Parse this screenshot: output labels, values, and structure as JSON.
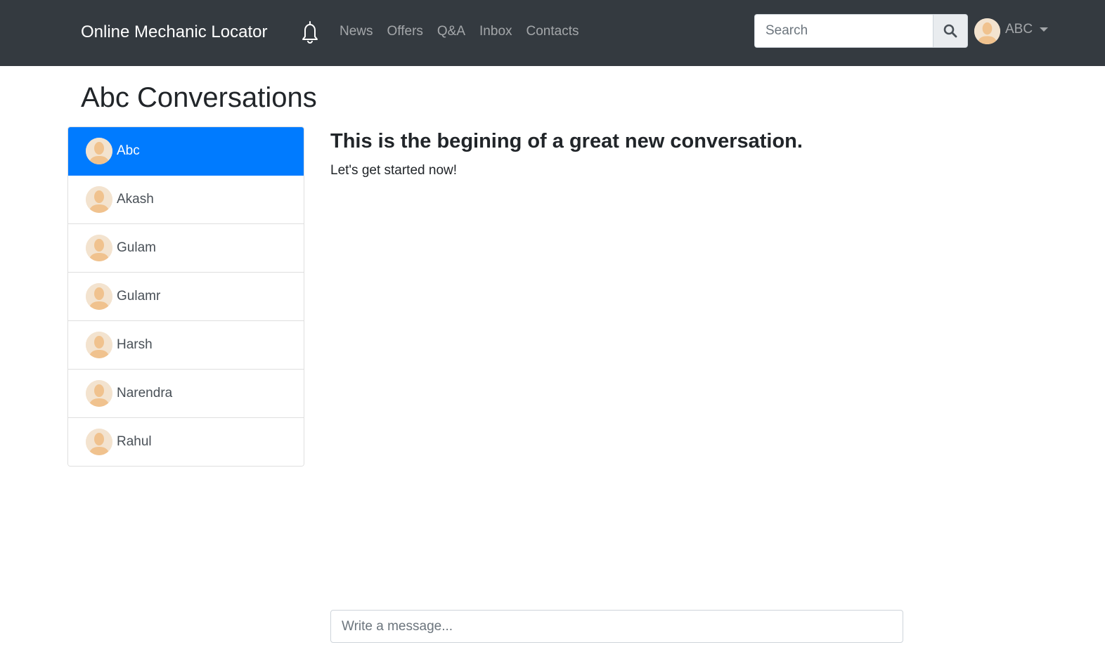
{
  "navbar": {
    "brand": "Online Mechanic Locator",
    "notification_icon": "bell-icon",
    "links": [
      "News",
      "Offers",
      "Q&A",
      "Inbox",
      "Contacts"
    ],
    "search": {
      "placeholder": "Search",
      "value": "",
      "button_icon": "search-icon"
    },
    "user": {
      "name": "ABC",
      "avatar_icon": "user-avatar-icon",
      "dropdown_icon": "caret-down-icon"
    }
  },
  "page": {
    "title": "Abc Conversations"
  },
  "contacts": [
    {
      "name": "Abc",
      "active": true
    },
    {
      "name": "Akash",
      "active": false
    },
    {
      "name": "Gulam",
      "active": false
    },
    {
      "name": "Gulamr",
      "active": false
    },
    {
      "name": "Harsh",
      "active": false
    },
    {
      "name": "Narendra",
      "active": false
    },
    {
      "name": "Rahul",
      "active": false
    }
  ],
  "conversation": {
    "heading": "This is the begining of a great new conversation.",
    "subtext": "Let's get started now!",
    "message_placeholder": "Write a message..."
  },
  "colors": {
    "navbar_bg": "#343a40",
    "active_item": "#007bff",
    "nav_link": "rgba(255,255,255,0.55)"
  }
}
